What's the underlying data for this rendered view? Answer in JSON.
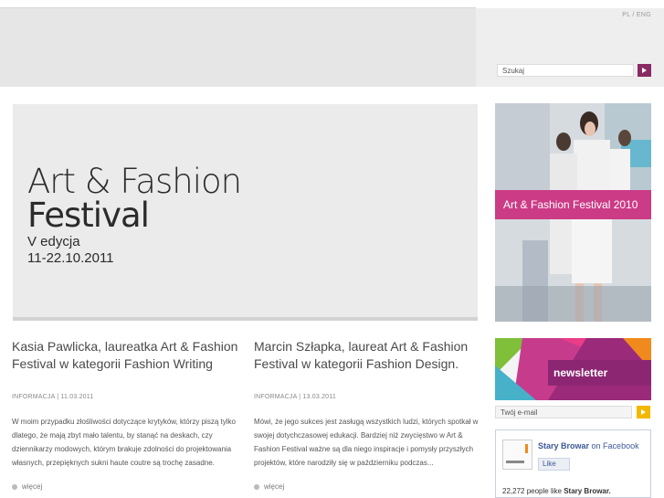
{
  "header": {
    "lang_pl": "PL",
    "lang_sep": "/",
    "lang_eng": "ENG",
    "search_value": "Szukaj"
  },
  "hero": {
    "title_line1": "Art & Fashion",
    "title_line2": "Festival",
    "edition": "V edycja",
    "dates": "11-22.10.2011"
  },
  "promo": {
    "label": "Art & Fashion Festival 2010"
  },
  "newsletter": {
    "label": "newsletter",
    "email_value": "Twój e-mail"
  },
  "facebook": {
    "name": "Stary Browar",
    "on": "on Facebook",
    "like": "Like",
    "count_prefix": "22,272 people like",
    "count_name": "Stary Browar."
  },
  "articles": [
    {
      "title": "Kasia Pawlicka, laureatka Art & Fashion Festival w kategorii Fashion Writing",
      "meta": "INFORMACJA | 11.03.2011",
      "body": "W moim przypadku złośliwości dotyczące krytyków, którzy piszą tylko dlatego, że mają zbyt mało talentu, by stanąć na deskach, czy dziennikarzy modowych, którym brakuje zdolności do projektowania własnych, przepięknych sukni haute coutre są trochę zasadne.",
      "more": "więcej"
    },
    {
      "title": "Marcin Szłapka, laureat Art & Fashion Festival w kategorii Fashion Design.",
      "meta": "INFORMACJA | 13.03.2011",
      "body": "Mówi, że jego sukces jest zasługą wszystkich ludzi, których spotkał w swojej dotychczasowej edukacji. Bardziej niż zwycięstwo w Art & Fashion Festival ważne są dla niego inspiracje i pomysły przyszłych projektów, które narodziły się w październiku podczas...",
      "more": "więcej"
    }
  ],
  "colors": {
    "accent_purple": "#8a2a63",
    "accent_pink": "#cc3b86",
    "accent_yellow": "#f2b800"
  }
}
